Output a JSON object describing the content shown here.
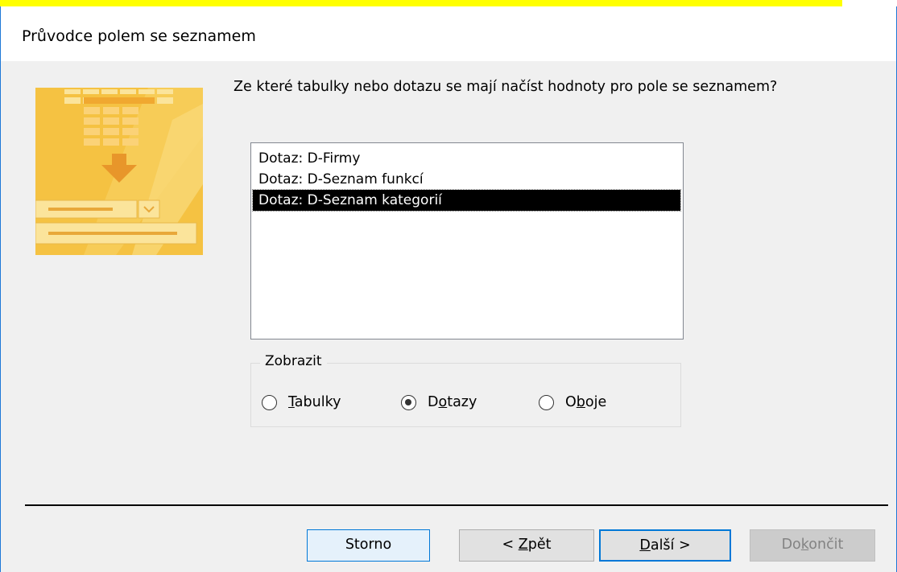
{
  "dialog": {
    "title": "Průvodce polem se seznamem",
    "question": "Ze které tabulky nebo dotazu se mají načíst hodnoty pro pole se seznamem?"
  },
  "list": {
    "items": [
      {
        "label": "Dotaz: D-Firmy",
        "selected": false
      },
      {
        "label": "Dotaz: D-Seznam funkcí",
        "selected": false
      },
      {
        "label": "Dotaz: D-Seznam kategorií",
        "selected": true
      }
    ]
  },
  "view_group": {
    "legend": "Zobrazit",
    "options": [
      {
        "pre": "",
        "key": "T",
        "post": "abulky",
        "checked": false
      },
      {
        "pre": "D",
        "key": "o",
        "post": "tazy",
        "checked": true
      },
      {
        "pre": "O",
        "key": "b",
        "post": "oje",
        "checked": false
      }
    ]
  },
  "buttons": {
    "cancel": "Storno",
    "back": {
      "pre": "< ",
      "key": "Z",
      "post": "pět"
    },
    "next": {
      "pre": "",
      "key": "D",
      "post": "alší >"
    },
    "finish": {
      "pre": "Do",
      "key": "k",
      "post": "ončit"
    }
  },
  "colors": {
    "highlight": "#ffff00",
    "accent": "#0078d7",
    "art_orange": "#f5c242"
  }
}
